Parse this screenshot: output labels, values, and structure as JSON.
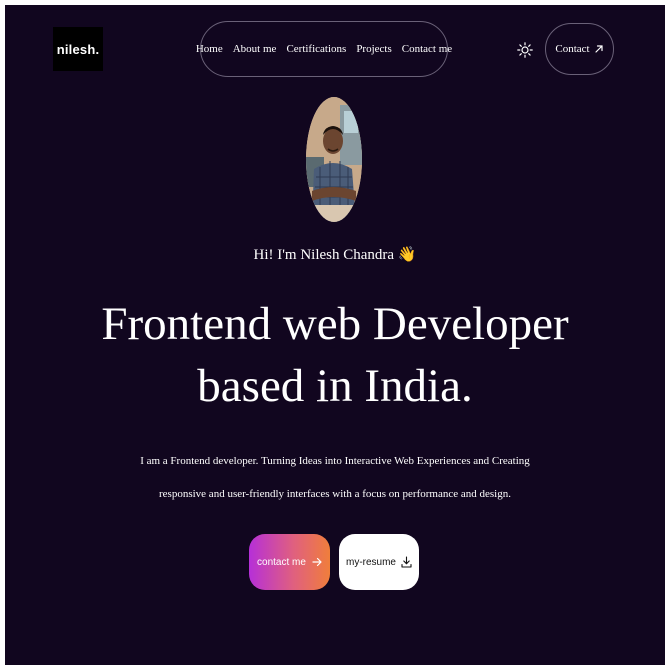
{
  "header": {
    "logo_text": "nilesh",
    "logo_dot": ".",
    "nav": [
      "Home",
      "About me",
      "Certifications",
      "Projects",
      "Contact me"
    ],
    "theme_icon": "sun-icon",
    "contact_label": "Contact",
    "contact_icon": "arrow-up-right-icon"
  },
  "hero": {
    "avatar_icon": "profile-photo",
    "greeting": "Hi! I'm Nilesh Chandra",
    "greeting_emoji": "👋",
    "headline_line1": "Frontend web Developer",
    "headline_line2": "based in India.",
    "description_line1": "I am a Frontend developer. Turning Ideas into Interactive Web Experiences and Creating",
    "description_line2": "responsive and user-friendly interfaces with a focus on performance and design.",
    "primary_button": "contact me",
    "primary_icon": "arrow-right-icon",
    "secondary_button": "my-resume",
    "secondary_icon": "download-icon"
  },
  "colors": {
    "background": "#11061f",
    "gradient_start": "#b62fd8",
    "gradient_end": "#f07e3b",
    "border": "#6a6178"
  }
}
